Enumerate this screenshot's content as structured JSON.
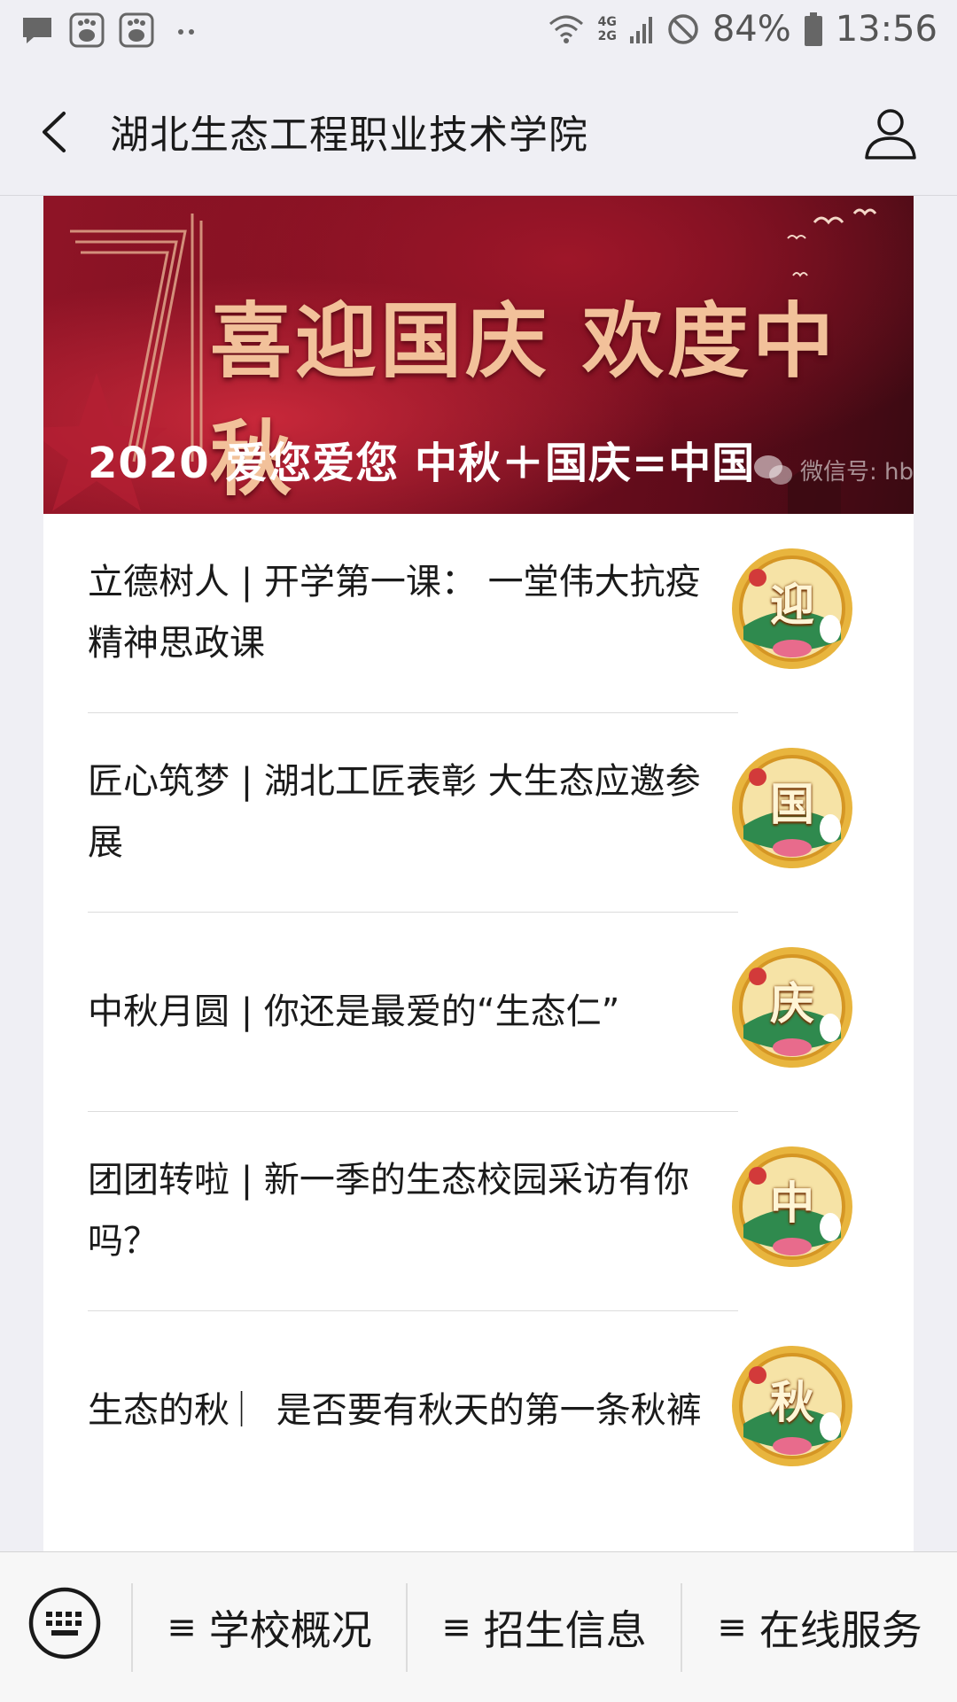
{
  "status_bar": {
    "battery": "84%",
    "time": "13:56",
    "network_top": "4G",
    "network_bottom": "2G"
  },
  "nav": {
    "title": "湖北生态工程职业技术学院"
  },
  "banner": {
    "headline": "喜迎国庆 欢度中秋",
    "subtitle": "2020 爱您爱您 中秋＋国庆=中国",
    "watermark": "微信号: hb"
  },
  "articles": [
    {
      "title": "立德树人 | 开学第一课： 一堂伟大抗疫精神思政课",
      "thumb_char": "迎"
    },
    {
      "title": "匠心筑梦 | 湖北工匠表彰 大生态应邀参展",
      "thumb_char": "国"
    },
    {
      "title": "中秋月圆 | 你还是最爱的“生态仁”",
      "thumb_char": "庆"
    },
    {
      "title": "团团转啦 | 新一季的生态校园采访有你吗？",
      "thumb_char": "中"
    },
    {
      "title": "生态的秋 ︳是否要有秋天的第一条秋裤",
      "thumb_char": "秋"
    }
  ],
  "bottom_menu": {
    "items": [
      {
        "label": "学校概况"
      },
      {
        "label": "招生信息"
      },
      {
        "label": "在线服务"
      }
    ]
  },
  "colors": {
    "banner_red": "#8f1426",
    "headline_gold": "#f2c19a",
    "thumb_gold": "#e8b53e",
    "thumb_green": "#2f8a4e"
  }
}
